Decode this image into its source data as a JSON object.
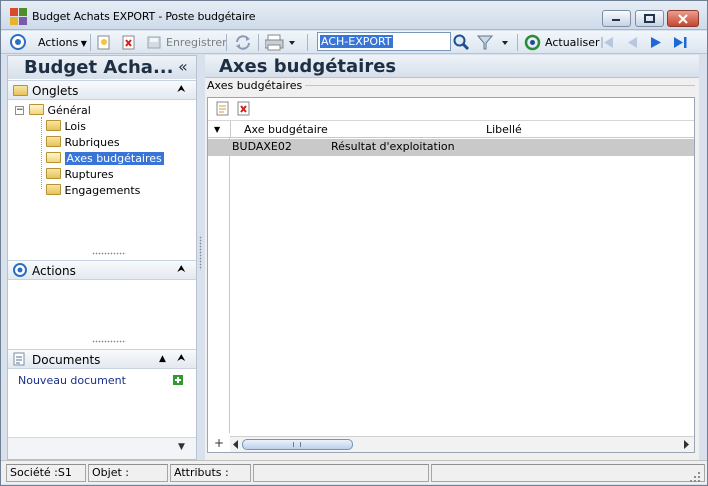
{
  "window": {
    "title": "Budget Achats EXPORT -  Poste budgétaire"
  },
  "toolbar": {
    "actions_label": "Actions",
    "save_label": "Enregistrer",
    "search_value": "ACH-EXPORT",
    "refresh_label": "Actualiser"
  },
  "left_panel": {
    "title": "Budget Acha...",
    "collapse_glyph": "«",
    "tabs_section": "Onglets",
    "tree": {
      "root": "Général",
      "items": [
        "Lois",
        "Rubriques",
        "Axes budgétaires",
        "Ruptures",
        "Engagements"
      ],
      "selected": "Axes budgétaires"
    },
    "actions_section": "Actions",
    "documents_section": "Documents",
    "new_document_label": "Nouveau document"
  },
  "main": {
    "title": "Axes budgétaires",
    "group_label": "Axes budgétaires",
    "grid": {
      "columns": [
        "Axe budgétaire",
        "Libellé"
      ],
      "rows": [
        {
          "axe": "BUDAXE02",
          "libelle": "Résultat d'exploitation"
        }
      ]
    }
  },
  "status_bar": {
    "societe": "Société :S1",
    "objet": "Objet :",
    "attributs": "Attributs :"
  },
  "colors": {
    "accent": "#3875d7",
    "selection": "#3875d7",
    "header_text": "#1e2f44",
    "link": "#1a2f8a"
  }
}
